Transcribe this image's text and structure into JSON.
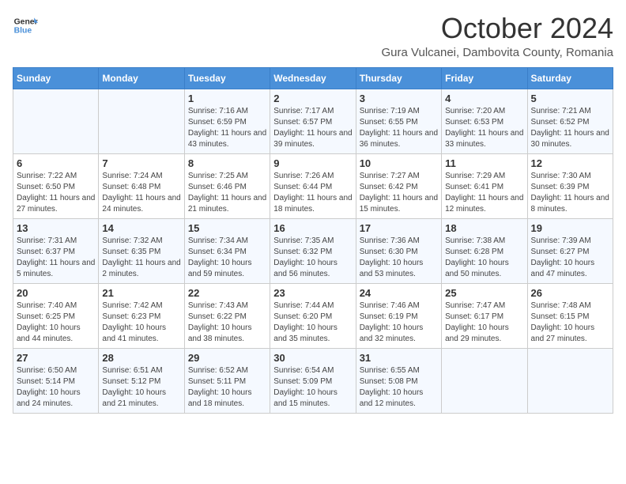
{
  "header": {
    "logo_line1": "General",
    "logo_line2": "Blue",
    "month": "October 2024",
    "location": "Gura Vulcanei, Dambovita County, Romania"
  },
  "days_of_week": [
    "Sunday",
    "Monday",
    "Tuesday",
    "Wednesday",
    "Thursday",
    "Friday",
    "Saturday"
  ],
  "weeks": [
    [
      {
        "day": "",
        "sunrise": "",
        "sunset": "",
        "daylight": ""
      },
      {
        "day": "",
        "sunrise": "",
        "sunset": "",
        "daylight": ""
      },
      {
        "day": "1",
        "sunrise": "Sunrise: 7:16 AM",
        "sunset": "Sunset: 6:59 PM",
        "daylight": "Daylight: 11 hours and 43 minutes."
      },
      {
        "day": "2",
        "sunrise": "Sunrise: 7:17 AM",
        "sunset": "Sunset: 6:57 PM",
        "daylight": "Daylight: 11 hours and 39 minutes."
      },
      {
        "day": "3",
        "sunrise": "Sunrise: 7:19 AM",
        "sunset": "Sunset: 6:55 PM",
        "daylight": "Daylight: 11 hours and 36 minutes."
      },
      {
        "day": "4",
        "sunrise": "Sunrise: 7:20 AM",
        "sunset": "Sunset: 6:53 PM",
        "daylight": "Daylight: 11 hours and 33 minutes."
      },
      {
        "day": "5",
        "sunrise": "Sunrise: 7:21 AM",
        "sunset": "Sunset: 6:52 PM",
        "daylight": "Daylight: 11 hours and 30 minutes."
      }
    ],
    [
      {
        "day": "6",
        "sunrise": "Sunrise: 7:22 AM",
        "sunset": "Sunset: 6:50 PM",
        "daylight": "Daylight: 11 hours and 27 minutes."
      },
      {
        "day": "7",
        "sunrise": "Sunrise: 7:24 AM",
        "sunset": "Sunset: 6:48 PM",
        "daylight": "Daylight: 11 hours and 24 minutes."
      },
      {
        "day": "8",
        "sunrise": "Sunrise: 7:25 AM",
        "sunset": "Sunset: 6:46 PM",
        "daylight": "Daylight: 11 hours and 21 minutes."
      },
      {
        "day": "9",
        "sunrise": "Sunrise: 7:26 AM",
        "sunset": "Sunset: 6:44 PM",
        "daylight": "Daylight: 11 hours and 18 minutes."
      },
      {
        "day": "10",
        "sunrise": "Sunrise: 7:27 AM",
        "sunset": "Sunset: 6:42 PM",
        "daylight": "Daylight: 11 hours and 15 minutes."
      },
      {
        "day": "11",
        "sunrise": "Sunrise: 7:29 AM",
        "sunset": "Sunset: 6:41 PM",
        "daylight": "Daylight: 11 hours and 12 minutes."
      },
      {
        "day": "12",
        "sunrise": "Sunrise: 7:30 AM",
        "sunset": "Sunset: 6:39 PM",
        "daylight": "Daylight: 11 hours and 8 minutes."
      }
    ],
    [
      {
        "day": "13",
        "sunrise": "Sunrise: 7:31 AM",
        "sunset": "Sunset: 6:37 PM",
        "daylight": "Daylight: 11 hours and 5 minutes."
      },
      {
        "day": "14",
        "sunrise": "Sunrise: 7:32 AM",
        "sunset": "Sunset: 6:35 PM",
        "daylight": "Daylight: 11 hours and 2 minutes."
      },
      {
        "day": "15",
        "sunrise": "Sunrise: 7:34 AM",
        "sunset": "Sunset: 6:34 PM",
        "daylight": "Daylight: 10 hours and 59 minutes."
      },
      {
        "day": "16",
        "sunrise": "Sunrise: 7:35 AM",
        "sunset": "Sunset: 6:32 PM",
        "daylight": "Daylight: 10 hours and 56 minutes."
      },
      {
        "day": "17",
        "sunrise": "Sunrise: 7:36 AM",
        "sunset": "Sunset: 6:30 PM",
        "daylight": "Daylight: 10 hours and 53 minutes."
      },
      {
        "day": "18",
        "sunrise": "Sunrise: 7:38 AM",
        "sunset": "Sunset: 6:28 PM",
        "daylight": "Daylight: 10 hours and 50 minutes."
      },
      {
        "day": "19",
        "sunrise": "Sunrise: 7:39 AM",
        "sunset": "Sunset: 6:27 PM",
        "daylight": "Daylight: 10 hours and 47 minutes."
      }
    ],
    [
      {
        "day": "20",
        "sunrise": "Sunrise: 7:40 AM",
        "sunset": "Sunset: 6:25 PM",
        "daylight": "Daylight: 10 hours and 44 minutes."
      },
      {
        "day": "21",
        "sunrise": "Sunrise: 7:42 AM",
        "sunset": "Sunset: 6:23 PM",
        "daylight": "Daylight: 10 hours and 41 minutes."
      },
      {
        "day": "22",
        "sunrise": "Sunrise: 7:43 AM",
        "sunset": "Sunset: 6:22 PM",
        "daylight": "Daylight: 10 hours and 38 minutes."
      },
      {
        "day": "23",
        "sunrise": "Sunrise: 7:44 AM",
        "sunset": "Sunset: 6:20 PM",
        "daylight": "Daylight: 10 hours and 35 minutes."
      },
      {
        "day": "24",
        "sunrise": "Sunrise: 7:46 AM",
        "sunset": "Sunset: 6:19 PM",
        "daylight": "Daylight: 10 hours and 32 minutes."
      },
      {
        "day": "25",
        "sunrise": "Sunrise: 7:47 AM",
        "sunset": "Sunset: 6:17 PM",
        "daylight": "Daylight: 10 hours and 29 minutes."
      },
      {
        "day": "26",
        "sunrise": "Sunrise: 7:48 AM",
        "sunset": "Sunset: 6:15 PM",
        "daylight": "Daylight: 10 hours and 27 minutes."
      }
    ],
    [
      {
        "day": "27",
        "sunrise": "Sunrise: 6:50 AM",
        "sunset": "Sunset: 5:14 PM",
        "daylight": "Daylight: 10 hours and 24 minutes."
      },
      {
        "day": "28",
        "sunrise": "Sunrise: 6:51 AM",
        "sunset": "Sunset: 5:12 PM",
        "daylight": "Daylight: 10 hours and 21 minutes."
      },
      {
        "day": "29",
        "sunrise": "Sunrise: 6:52 AM",
        "sunset": "Sunset: 5:11 PM",
        "daylight": "Daylight: 10 hours and 18 minutes."
      },
      {
        "day": "30",
        "sunrise": "Sunrise: 6:54 AM",
        "sunset": "Sunset: 5:09 PM",
        "daylight": "Daylight: 10 hours and 15 minutes."
      },
      {
        "day": "31",
        "sunrise": "Sunrise: 6:55 AM",
        "sunset": "Sunset: 5:08 PM",
        "daylight": "Daylight: 10 hours and 12 minutes."
      },
      {
        "day": "",
        "sunrise": "",
        "sunset": "",
        "daylight": ""
      },
      {
        "day": "",
        "sunrise": "",
        "sunset": "",
        "daylight": ""
      }
    ]
  ]
}
